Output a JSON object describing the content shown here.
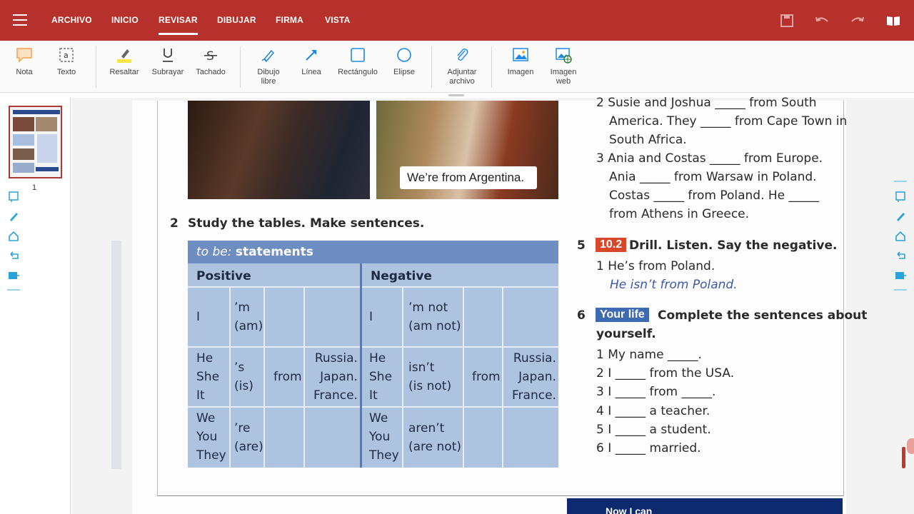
{
  "menu": {
    "items": [
      "ARCHIVO",
      "INICIO",
      "REVISAR",
      "DIBUJAR",
      "FIRMA",
      "VISTA"
    ],
    "active": "REVISAR"
  },
  "toolbar": {
    "nota": "Nota",
    "texto": "Texto",
    "resaltar": "Resaltar",
    "subrayar": "Subrayar",
    "tachado": "Tachado",
    "dibujo_libre": "Dibujo libre",
    "linea": "Línea",
    "rectangulo": "Rectángulo",
    "elipse": "Elipse",
    "adjuntar": "Adjuntar archivo",
    "imagen": "Imagen",
    "imagen_web": "Imagen web"
  },
  "thumbnails": {
    "page_number": "1"
  },
  "page": {
    "caption": "We’re from Argentina.",
    "ex2_num": "2",
    "ex2_title": "Study the tables. Make sentences.",
    "table": {
      "title_italic": "to be:",
      "title_rest": "statements",
      "positive": "Positive",
      "negative": "Negative",
      "pos_rows": [
        {
          "subj": "I",
          "verb": "’m\n(am)"
        },
        {
          "subj": "He\nShe\nIt",
          "verb": "’s\n(is)"
        },
        {
          "subj": "We\nYou\nThey",
          "verb": "’re\n(are)"
        }
      ],
      "neg_rows": [
        {
          "subj": "I",
          "verb": "’m not\n(am not)"
        },
        {
          "subj": "He\nShe\nIt",
          "verb": "isn’t\n(is not)"
        },
        {
          "subj": "We\nYou\nThey",
          "verb": "aren’t\n(are not)"
        }
      ],
      "from": "from",
      "countries": "Russia.\nJapan.\nFrance."
    },
    "right": {
      "line_a": "2  Susie and Joshua _____ from South",
      "line_b": "America. They _____ from Cape Town in",
      "line_c": "South Africa.",
      "line_d": "3  Ania and Costas _____ from Europe.",
      "line_e": "Ania _____ from Warsaw in Poland.",
      "line_f": "Costas _____ from Poland. He _____",
      "line_g": "from Athens in Greece.",
      "ex5_num": "5",
      "ex5_badge": "10.2",
      "ex5_title": "Drill. Listen. Say the negative.",
      "ex5_item": "1  He’s from Poland.",
      "ex5_answer": "He isn’t from Poland.",
      "ex6_num": "6",
      "ex6_badge": "Your life",
      "ex6_title_a": "Complete the sentences about",
      "ex6_title_b": "yourself.",
      "ex6_items": [
        "1  My name _____.",
        "2  I _____ from the USA.",
        "3  I _____ from _____.",
        "4  I _____ a teacher.",
        "5  I _____ a student.",
        "6  I _____ married."
      ],
      "bottom_label": "Now I can"
    }
  },
  "colors": {
    "brand": "#b7312c",
    "table_bg": "#aec3e0",
    "table_head": "#6e8dc0",
    "accent_icon": "#1e88e5",
    "badge_red": "#d9472b",
    "badge_blue": "#3d6bb3"
  },
  "icons": [
    "menu-icon",
    "save-icon",
    "undo-icon",
    "redo-icon",
    "reading-mode-icon"
  ]
}
